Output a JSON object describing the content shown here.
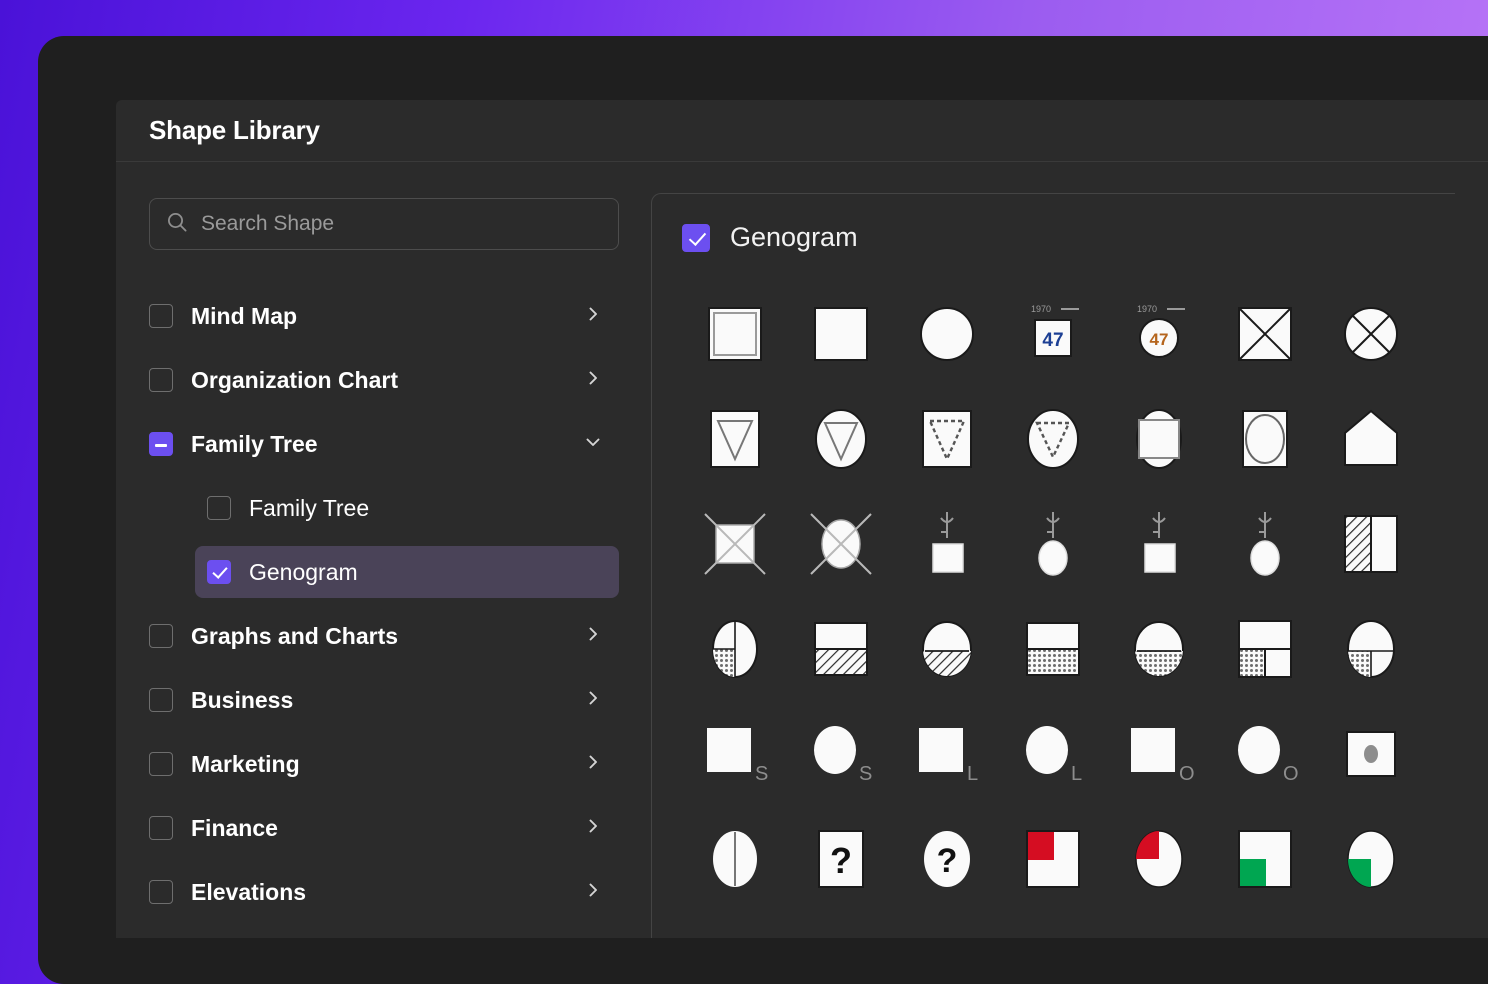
{
  "window": {
    "title": "Shape Library"
  },
  "search": {
    "placeholder": "Search Shape",
    "value": "",
    "icon": "search-icon"
  },
  "sidebar": {
    "items": [
      {
        "label": "Mind Map",
        "checkbox": "unchecked",
        "expander": "chevron-right-icon",
        "level": 0,
        "selected": false
      },
      {
        "label": "Organization Chart",
        "checkbox": "unchecked",
        "expander": "chevron-right-icon",
        "level": 0,
        "selected": false
      },
      {
        "label": "Family Tree",
        "checkbox": "indeterminate",
        "expander": "chevron-down-icon",
        "level": 0,
        "selected": false
      },
      {
        "label": "Family Tree",
        "checkbox": "unchecked",
        "expander": "none",
        "level": 1,
        "selected": false
      },
      {
        "label": "Genogram",
        "checkbox": "checked",
        "expander": "none",
        "level": 1,
        "selected": true
      },
      {
        "label": "Graphs and Charts",
        "checkbox": "unchecked",
        "expander": "chevron-right-icon",
        "level": 0,
        "selected": false
      },
      {
        "label": "Business",
        "checkbox": "unchecked",
        "expander": "chevron-right-icon",
        "level": 0,
        "selected": false
      },
      {
        "label": "Marketing",
        "checkbox": "unchecked",
        "expander": "chevron-right-icon",
        "level": 0,
        "selected": false
      },
      {
        "label": "Finance",
        "checkbox": "unchecked",
        "expander": "chevron-right-icon",
        "level": 0,
        "selected": false
      },
      {
        "label": "Elevations",
        "checkbox": "unchecked",
        "expander": "chevron-right-icon",
        "level": 0,
        "selected": false
      }
    ]
  },
  "shapes_panel": {
    "group_label": "Genogram",
    "group_checkbox": "checked",
    "age_label": "1970",
    "age_value": "47",
    "unknown_glyph": "?",
    "subscripts": [
      "S",
      "S",
      "L",
      "L",
      "O",
      "O"
    ],
    "rows": [
      [
        "male-square",
        "male-square-plain",
        "female-circle",
        "male-with-age-1970-47",
        "female-with-age-1970-47",
        "male-deceased-x-square",
        "female-deceased-x-circle"
      ],
      [
        "male-pregnancy-triangle-square",
        "female-pregnancy-triangle-circle",
        "male-dashed-triangle-square",
        "female-dashed-triangle-circle",
        "circle-over-square",
        "square-with-circle",
        "house-pentagon"
      ],
      [
        "male-death-x-outline",
        "female-death-x-outline",
        "male-abortion-stem-square",
        "female-abortion-stem-circle",
        "male-stem-square-alt",
        "female-stem-circle-alt",
        "square-half-hatched"
      ],
      [
        "circle-quarter-dotted",
        "square-bottom-hatched",
        "circle-bottom-hatched",
        "square-bottom-dotted",
        "circle-bottom-dotted",
        "square-quadrant-dotted",
        "circle-quadrant-dotted"
      ],
      [
        "male-separated-S",
        "female-separated-S",
        "male-living-L",
        "female-living-L",
        "male-other-O",
        "female-other-O",
        "square-with-dot"
      ],
      [
        "circle-split-vertical",
        "square-unknown-question",
        "circle-unknown-question",
        "square-red-quadrant",
        "circle-red-quadrant",
        "square-green-quadrant",
        "circle-green-quadrant"
      ]
    ]
  },
  "colors": {
    "accent": "#6C4FF0",
    "panel_bg": "#2B2B2B",
    "window_bg": "#1F1F1F",
    "selected_row": "#4A4358",
    "shape_fill": "#FAFAFA",
    "shape_stroke": "#1A1A1A",
    "status_red": "#D50D22",
    "status_green": "#00A651",
    "background_gradient_start": "#4A12D8",
    "background_gradient_end": "#C07AF8"
  }
}
